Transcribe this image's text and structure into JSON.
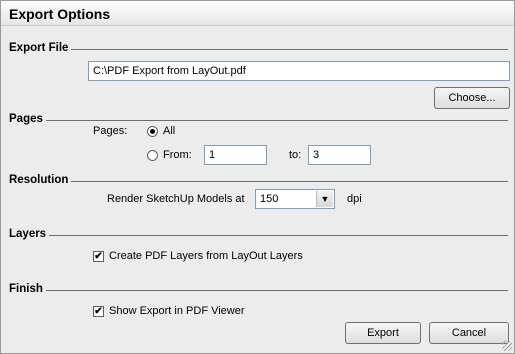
{
  "dialog": {
    "title": "Export Options"
  },
  "sections": {
    "export_file": "Export File",
    "pages": "Pages",
    "resolution": "Resolution",
    "layers": "Layers",
    "finish": "Finish"
  },
  "export_file": {
    "path": "C:\\PDF Export from LayOut.pdf",
    "choose_label": "Choose..."
  },
  "pages": {
    "label": "Pages:",
    "all_label": "All",
    "from_label": "From:",
    "from_value": "1",
    "to_label": "to:",
    "to_value": "3",
    "selected": "All"
  },
  "resolution": {
    "label": "Render SketchUp Models at",
    "value": "150",
    "unit": "dpi"
  },
  "layers": {
    "checkbox_label": "Create PDF Layers from LayOut Layers",
    "checked": true
  },
  "finish": {
    "checkbox_label": "Show Export in PDF Viewer",
    "checked": true
  },
  "buttons": {
    "export": "Export",
    "cancel": "Cancel"
  },
  "icons": {
    "check_mark": "✔",
    "dropdown_arrow": "▼"
  }
}
